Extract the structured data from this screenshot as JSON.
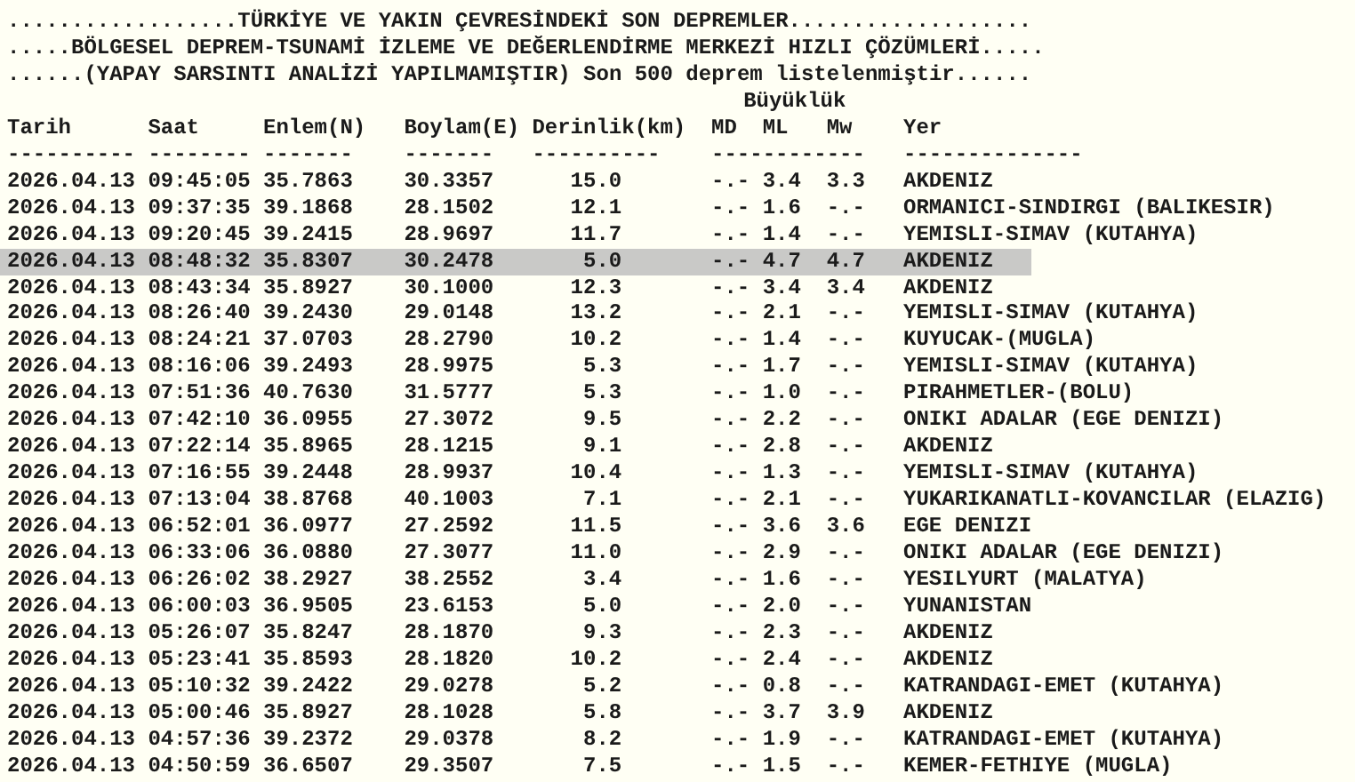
{
  "header_lines": [
    "..................TÜRKİYE VE YAKIN ÇEVRESİNDEKİ SON DEPREMLER...................",
    ".....BÖLGESEL DEPREM-TSUNAMİ İZLEME VE DEĞERLENDİRME MERKEZİ HIZLI ÇÖZÜMLERİ.....",
    "......(YAPAY SARSINTI ANALİZİ YAPILMAMIŞTIR) Son 500 deprem listelenmiştir......"
  ],
  "magnitude_group_label": "Büyüklük",
  "table": {
    "columns": [
      "Tarih",
      "Saat",
      "Enlem(N)",
      "Boylam(E)",
      "Derinlik(km)",
      "MD",
      "ML",
      "Mw",
      "Yer"
    ],
    "separators": [
      "----------",
      "--------",
      "-------",
      "-------",
      "----------",
      "------------",
      "--------------"
    ],
    "rows": [
      {
        "date": "2026.04.13",
        "time": "09:45:05",
        "lat": "35.7863",
        "lon": "30.3357",
        "depth": "15.0",
        "md": "-.-",
        "ml": "3.4",
        "mw": "3.3",
        "place": "AKDENIZ",
        "selected": false
      },
      {
        "date": "2026.04.13",
        "time": "09:37:35",
        "lat": "39.1868",
        "lon": "28.1502",
        "depth": "12.1",
        "md": "-.-",
        "ml": "1.6",
        "mw": "-.-",
        "place": "ORMANICI-SINDIRGI (BALIKESIR)",
        "selected": false
      },
      {
        "date": "2026.04.13",
        "time": "09:20:45",
        "lat": "39.2415",
        "lon": "28.9697",
        "depth": "11.7",
        "md": "-.-",
        "ml": "1.4",
        "mw": "-.-",
        "place": "YEMISLI-SIMAV (KUTAHYA)",
        "selected": false
      },
      {
        "date": "2026.04.13",
        "time": "08:48:32",
        "lat": "35.8307",
        "lon": "30.2478",
        "depth": "5.0",
        "md": "-.-",
        "ml": "4.7",
        "mw": "4.7",
        "place": "AKDENIZ",
        "selected": true
      },
      {
        "date": "2026.04.13",
        "time": "08:43:34",
        "lat": "35.8927",
        "lon": "30.1000",
        "depth": "12.3",
        "md": "-.-",
        "ml": "3.4",
        "mw": "3.4",
        "place": "AKDENIZ",
        "selected": false
      },
      {
        "date": "2026.04.13",
        "time": "08:26:40",
        "lat": "39.2430",
        "lon": "29.0148",
        "depth": "13.2",
        "md": "-.-",
        "ml": "2.1",
        "mw": "-.-",
        "place": "YEMISLI-SIMAV (KUTAHYA)",
        "selected": false
      },
      {
        "date": "2026.04.13",
        "time": "08:24:21",
        "lat": "37.0703",
        "lon": "28.2790",
        "depth": "10.2",
        "md": "-.-",
        "ml": "1.4",
        "mw": "-.-",
        "place": "KUYUCAK-(MUGLA)",
        "selected": false
      },
      {
        "date": "2026.04.13",
        "time": "08:16:06",
        "lat": "39.2493",
        "lon": "28.9975",
        "depth": "5.3",
        "md": "-.-",
        "ml": "1.7",
        "mw": "-.-",
        "place": "YEMISLI-SIMAV (KUTAHYA)",
        "selected": false
      },
      {
        "date": "2026.04.13",
        "time": "07:51:36",
        "lat": "40.7630",
        "lon": "31.5777",
        "depth": "5.3",
        "md": "-.-",
        "ml": "1.0",
        "mw": "-.-",
        "place": "PIRAHMETLER-(BOLU)",
        "selected": false
      },
      {
        "date": "2026.04.13",
        "time": "07:42:10",
        "lat": "36.0955",
        "lon": "27.3072",
        "depth": "9.5",
        "md": "-.-",
        "ml": "2.2",
        "mw": "-.-",
        "place": "ONIKI ADALAR (EGE DENIZI)",
        "selected": false
      },
      {
        "date": "2026.04.13",
        "time": "07:22:14",
        "lat": "35.8965",
        "lon": "28.1215",
        "depth": "9.1",
        "md": "-.-",
        "ml": "2.8",
        "mw": "-.-",
        "place": "AKDENIZ",
        "selected": false
      },
      {
        "date": "2026.04.13",
        "time": "07:16:55",
        "lat": "39.2448",
        "lon": "28.9937",
        "depth": "10.4",
        "md": "-.-",
        "ml": "1.3",
        "mw": "-.-",
        "place": "YEMISLI-SIMAV (KUTAHYA)",
        "selected": false
      },
      {
        "date": "2026.04.13",
        "time": "07:13:04",
        "lat": "38.8768",
        "lon": "40.1003",
        "depth": "7.1",
        "md": "-.-",
        "ml": "2.1",
        "mw": "-.-",
        "place": "YUKARIKANATLI-KOVANCILAR (ELAZIG)",
        "selected": false
      },
      {
        "date": "2026.04.13",
        "time": "06:52:01",
        "lat": "36.0977",
        "lon": "27.2592",
        "depth": "11.5",
        "md": "-.-",
        "ml": "3.6",
        "mw": "3.6",
        "place": "EGE DENIZI",
        "selected": false
      },
      {
        "date": "2026.04.13",
        "time": "06:33:06",
        "lat": "36.0880",
        "lon": "27.3077",
        "depth": "11.0",
        "md": "-.-",
        "ml": "2.9",
        "mw": "-.-",
        "place": "ONIKI ADALAR (EGE DENIZI)",
        "selected": false
      },
      {
        "date": "2026.04.13",
        "time": "06:26:02",
        "lat": "38.2927",
        "lon": "38.2552",
        "depth": "3.4",
        "md": "-.-",
        "ml": "1.6",
        "mw": "-.-",
        "place": "YESILYURT (MALATYA)",
        "selected": false
      },
      {
        "date": "2026.04.13",
        "time": "06:00:03",
        "lat": "36.9505",
        "lon": "23.6153",
        "depth": "5.0",
        "md": "-.-",
        "ml": "2.0",
        "mw": "-.-",
        "place": "YUNANISTAN",
        "selected": false
      },
      {
        "date": "2026.04.13",
        "time": "05:26:07",
        "lat": "35.8247",
        "lon": "28.1870",
        "depth": "9.3",
        "md": "-.-",
        "ml": "2.3",
        "mw": "-.-",
        "place": "AKDENIZ",
        "selected": false
      },
      {
        "date": "2026.04.13",
        "time": "05:23:41",
        "lat": "35.8593",
        "lon": "28.1820",
        "depth": "10.2",
        "md": "-.-",
        "ml": "2.4",
        "mw": "-.-",
        "place": "AKDENIZ",
        "selected": false
      },
      {
        "date": "2026.04.13",
        "time": "05:10:32",
        "lat": "39.2422",
        "lon": "29.0278",
        "depth": "5.2",
        "md": "-.-",
        "ml": "0.8",
        "mw": "-.-",
        "place": "KATRANDAGI-EMET (KUTAHYA)",
        "selected": false
      },
      {
        "date": "2026.04.13",
        "time": "05:00:46",
        "lat": "35.8927",
        "lon": "28.1028",
        "depth": "5.8",
        "md": "-.-",
        "ml": "3.7",
        "mw": "3.9",
        "place": "AKDENIZ",
        "selected": false
      },
      {
        "date": "2026.04.13",
        "time": "04:57:36",
        "lat": "39.2372",
        "lon": "29.0378",
        "depth": "8.2",
        "md": "-.-",
        "ml": "1.9",
        "mw": "-.-",
        "place": "KATRANDAGI-EMET (KUTAHYA)",
        "selected": false
      },
      {
        "date": "2026.04.13",
        "time": "04:50:59",
        "lat": "36.6507",
        "lon": "29.3507",
        "depth": "7.5",
        "md": "-.-",
        "ml": "1.5",
        "mw": "-.-",
        "place": "KEMER-FETHIYE (MUGLA)",
        "selected": false
      }
    ]
  }
}
